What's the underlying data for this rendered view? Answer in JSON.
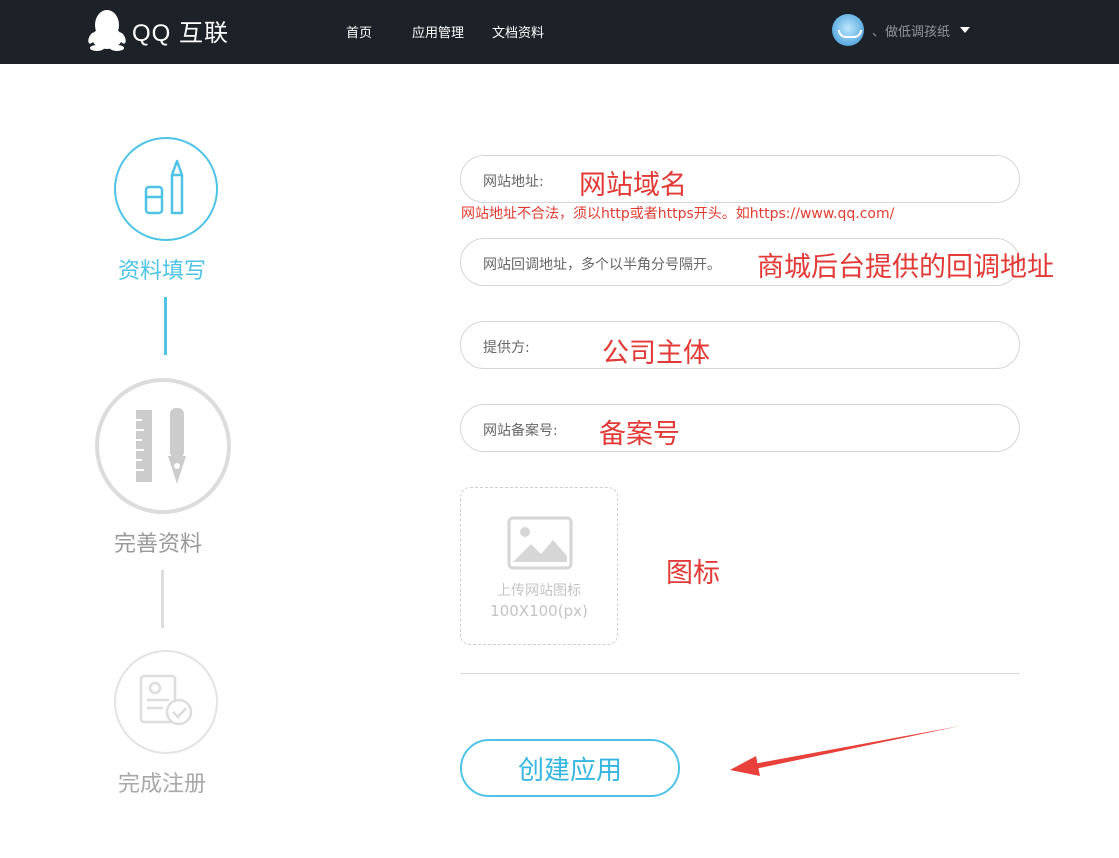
{
  "header": {
    "logo_text": "QQ 互联",
    "nav": [
      {
        "label": "首页"
      },
      {
        "label": "应用管理"
      },
      {
        "label": "文档资料"
      }
    ],
    "user_name": "、做低调孩纸"
  },
  "steps": [
    {
      "label": "资料填写",
      "state": "active",
      "icon": "pencil-ruler-icon"
    },
    {
      "label": "完善资料",
      "state": "inactive",
      "icon": "ruler-pen-icon"
    },
    {
      "label": "完成注册",
      "state": "inactive",
      "icon": "document-check-icon"
    }
  ],
  "form": {
    "website_url": {
      "label": "网站地址:",
      "value": "网站域名"
    },
    "error_message": "网站地址不合法，须以http或者https开头。如https://www.qq.com/",
    "callback_url": {
      "placeholder": "网站回调地址，多个以半角分号隔开。",
      "value": "商城后台提供的回调地址"
    },
    "provider": {
      "label": "提供方:",
      "value": "公司主体"
    },
    "icp": {
      "label": "网站备案号:",
      "value": "备案号"
    },
    "upload": {
      "line1": "上传网站图标",
      "line2": "100X100(px)",
      "annotation": "图标"
    },
    "submit_label": "创建应用"
  },
  "colors": {
    "header_bg": "#1c2228",
    "accent": "#4ec3e6",
    "annotation_red": "#e23a36"
  }
}
